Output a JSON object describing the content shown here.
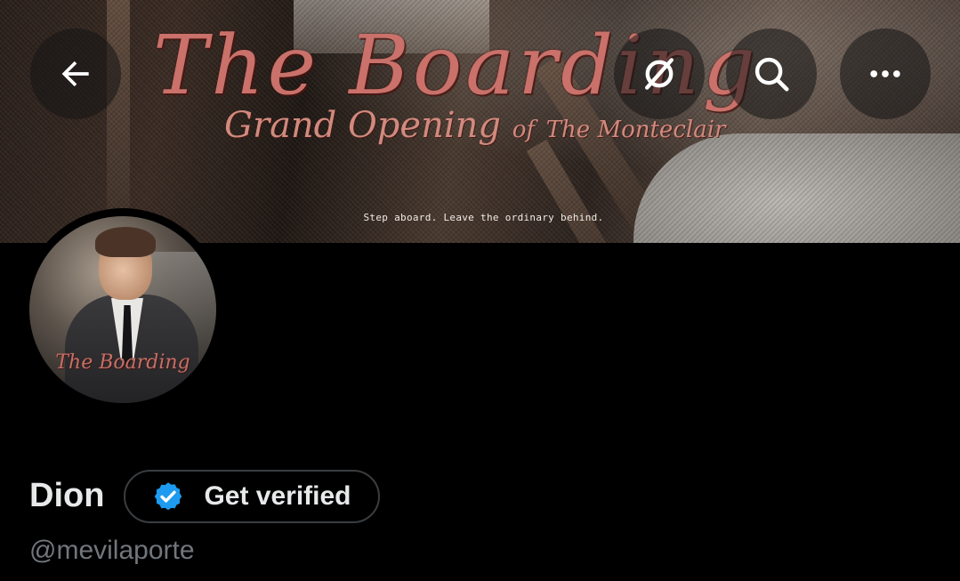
{
  "banner": {
    "title_script": "The Boarding",
    "subtitle_main": "Grand Opening",
    "subtitle_of": "of",
    "subtitle_rest": "The Monteclair",
    "tagline": "Step aboard. Leave the ordinary behind."
  },
  "nav": {
    "back_icon": "arrow-left-icon",
    "grok_icon": "grok-icon",
    "search_icon": "search-icon",
    "more_icon": "more-horizontal-icon"
  },
  "avatar": {
    "script": "The Boarding"
  },
  "profile": {
    "display_name": "Dion",
    "get_verified_label": "Get verified",
    "handle": "@mevilaporte"
  },
  "colors": {
    "background": "#000000",
    "primary_text": "#e7e9ea",
    "secondary_text": "#71767b",
    "verified_blue": "#1d9bf0",
    "button_border": "#3a3d40"
  }
}
